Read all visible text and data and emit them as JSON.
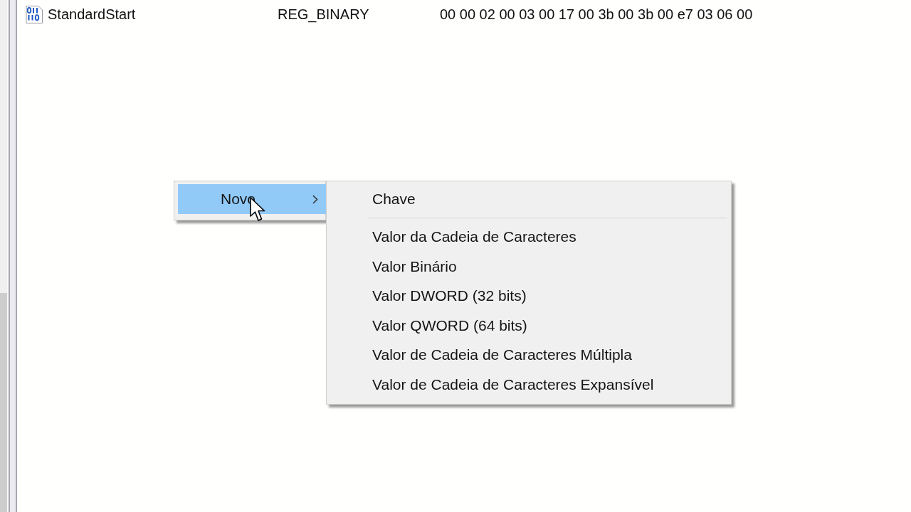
{
  "list_view": {
    "rows": [
      {
        "name": "StandardStart",
        "type": "REG_BINARY",
        "data": "00 00 02 00 03 00 17 00 3b 00 3b 00 e7 03 06 00",
        "selected": false
      }
    ]
  },
  "context_menu": {
    "items": [
      {
        "label": "Novo",
        "selected": true,
        "has_submenu": true
      }
    ]
  },
  "submenu": {
    "items": [
      {
        "kind": "item",
        "label": "Chave",
        "selected": false
      },
      {
        "kind": "separator"
      },
      {
        "kind": "item",
        "label": "Valor da Cadeia de Caracteres",
        "selected": false
      },
      {
        "kind": "item",
        "label": "Valor Binário",
        "selected": false
      },
      {
        "kind": "item",
        "label": "Valor DWORD (32 bits)",
        "selected": false
      },
      {
        "kind": "item",
        "label": "Valor QWORD (64 bits)",
        "selected": false
      },
      {
        "kind": "item",
        "label": "Valor de Cadeia de Caracteres Múltipla",
        "selected": false
      },
      {
        "kind": "item",
        "label": "Valor de Cadeia de Caracteres Expansível",
        "selected": false
      }
    ]
  }
}
